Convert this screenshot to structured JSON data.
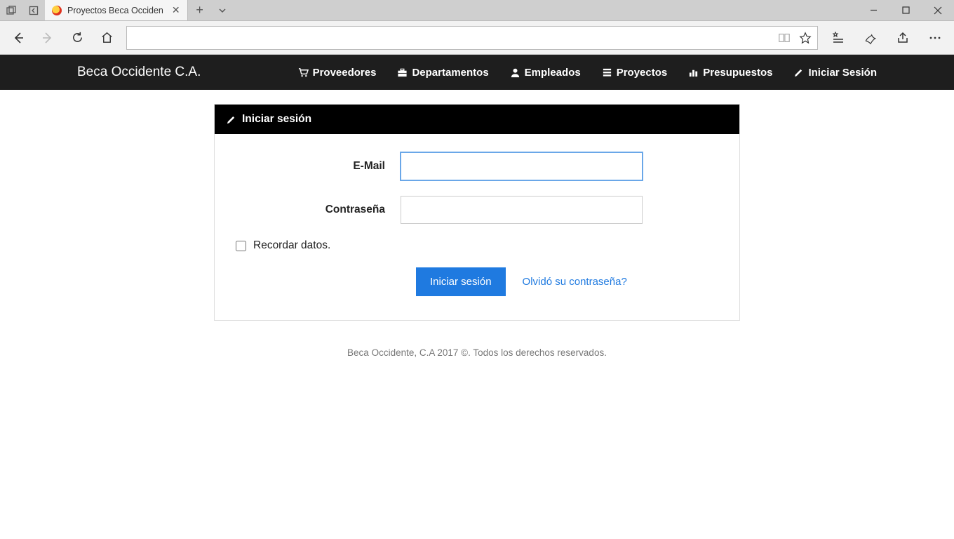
{
  "browser": {
    "tab_title": "Proyectos Beca Occiden"
  },
  "navbar": {
    "brand": "Beca Occidente C.A.",
    "items": [
      {
        "label": "Proveedores"
      },
      {
        "label": "Departamentos"
      },
      {
        "label": "Empleados"
      },
      {
        "label": "Proyectos"
      },
      {
        "label": "Presupuestos"
      },
      {
        "label": "Iniciar Sesión"
      }
    ]
  },
  "panel": {
    "title": "Iniciar sesión",
    "email_label": "E-Mail",
    "password_label": "Contraseña",
    "remember_label": "Recordar datos.",
    "submit_label": "Iniciar sesión",
    "forgot_label": "Olvidó su contraseña?",
    "email_value": "",
    "password_value": ""
  },
  "footer": {
    "text": "Beca Occidente, C.A 2017 ©. Todos los derechos reservados."
  }
}
